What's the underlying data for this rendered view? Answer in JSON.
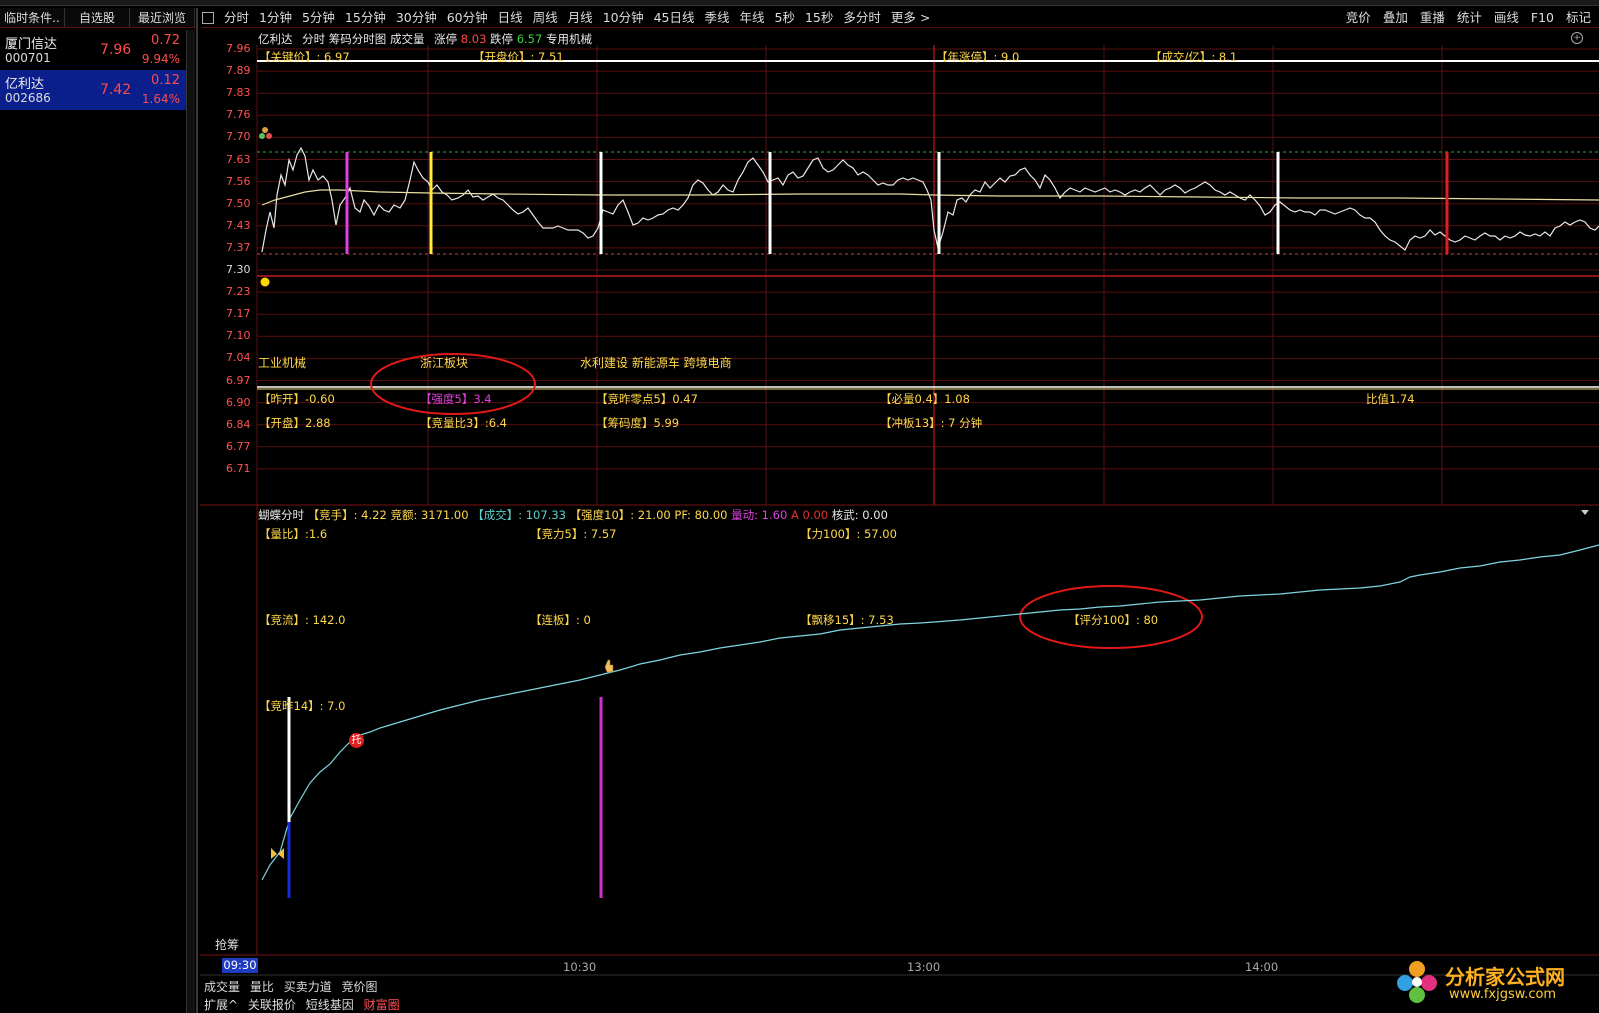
{
  "left_tabs": [
    "临时条件..",
    "自选股",
    "最近浏览"
  ],
  "watchlist": [
    {
      "name": "厦门信达",
      "code": "000701",
      "price": "7.96",
      "change": "0.72",
      "pct": "9.94%"
    },
    {
      "name": "亿利达",
      "code": "002686",
      "price": "7.42",
      "change": "0.12",
      "pct": "1.64%"
    }
  ],
  "period_tabs": [
    "分时",
    "1分钟",
    "5分钟",
    "15分钟",
    "30分钟",
    "60分钟",
    "日线",
    "周线",
    "月线",
    "10分钟",
    "45日线",
    "季线",
    "年线",
    "5秒",
    "15秒",
    "多分时",
    "更多 >"
  ],
  "tool_tabs": [
    "竞价",
    "叠加",
    "重播",
    "统计",
    "画线",
    "F10",
    "标记"
  ],
  "chart_header": {
    "stock": "亿利达",
    "mode": "分时 筹码分时图",
    "volume": "成交量",
    "limit_up_label": "涨停",
    "limit_up": "8.03",
    "limit_down_label": "跌停",
    "limit_down": "6.57",
    "sector": "专用机械"
  },
  "price_axis": [
    "7.96",
    "7.89",
    "7.83",
    "7.76",
    "7.70",
    "7.63",
    "7.56",
    "7.50",
    "7.43",
    "7.37",
    "7.30",
    "7.23",
    "7.17",
    "7.10",
    "7.04",
    "6.97",
    "6.90",
    "6.84",
    "6.77",
    "6.71"
  ],
  "top_labels": {
    "key_price": "【关键价】: 6.97",
    "open_price": "【开盘价】: 7.51",
    "year_limit": "【年涨停】: 9.0",
    "turnover": "【成交/亿】: 8.1"
  },
  "concepts": {
    "c1": "工业机械",
    "c2": "浙江板块",
    "c3": "水利建设 新能源车 跨境电商"
  },
  "mid_labels": {
    "zuokai": "【昨开】-0.60",
    "qiangdu": "【强度5】3.4",
    "jingzuo": "【竞昨零点5】0.47",
    "bili": "【必量0.4】1.08",
    "bizhi": "比值1.74",
    "kaipan": "【开盘】2.88",
    "jingliang": "【竞量比3】:6.4",
    "chouma": "【筹码度】5.99",
    "chongban": "【冲板13】: 7 分钟"
  },
  "lower_header": {
    "t1": "蝴蝶分时",
    "t2": "【竞手】: 4.22",
    "t3": "竞额: 3171.00",
    "t4": "【成交】: 107.33",
    "t5": "【强度10】: 21.00",
    "t6": "PF: 80.00",
    "t7": "量动: 1.60",
    "t8": "A",
    "t9": "0.00",
    "t10": "核武: 0.00"
  },
  "lower_labels": {
    "liangbi": "【量比】:1.6",
    "jingli": "【竞力5】: 7.57",
    "li100": "【力100】: 57.00",
    "jingliu": "【竞流】: 142.0",
    "lianban": "【连板】: 0",
    "piaoyi": "【飘移15】: 7.53",
    "pingfen": "【评分100】: 80",
    "jingxiao": "【竞昨14】: 7.0",
    "tuo": "托"
  },
  "side_button": "抢筹",
  "time_axis": [
    "09:30",
    "10:30",
    "13:00",
    "14:00"
  ],
  "bottom_tabs": [
    "成交量",
    "量比",
    "买卖力道",
    "竞价图"
  ],
  "bottom_tabs2": [
    "扩展^",
    "关联报价",
    "短线基因",
    "财富圈"
  ],
  "watermark": {
    "title": "分析家公式网",
    "url": "www.fxjgsw.com"
  }
}
